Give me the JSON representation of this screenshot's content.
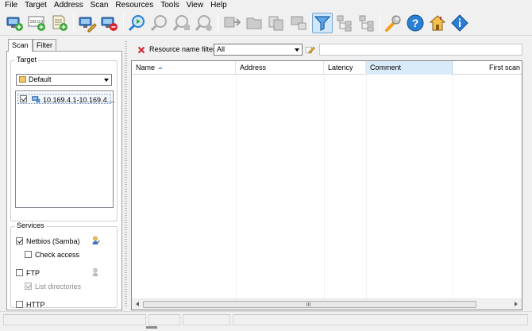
{
  "menu": [
    "File",
    "Target",
    "Address",
    "Scan",
    "Resources",
    "Tools",
    "View",
    "Help"
  ],
  "toolbar": {
    "icons": [
      "add-target-icon",
      "ip-address-icon",
      "add-list-icon",
      "edit-target-icon",
      "remove-target-icon",
      "scan-icon",
      "scan-disabled-icon",
      "scan-next-disabled-icon",
      "stop-scan-disabled-icon",
      "export-disabled-icon",
      "open-resource-disabled-icon",
      "copy-disabled-icon",
      "network-disabled-icon",
      "filter-icon",
      "tree-disabled-icon",
      "tree-expand-disabled-icon",
      "settings-wrench-icon",
      "help-icon",
      "home-icon",
      "about-icon"
    ],
    "ip_icon_text": "192.0.0"
  },
  "left": {
    "tabs": [
      "Scan",
      "Filter"
    ],
    "target_group_label": "Target",
    "target_select_value": "Default",
    "targets": [
      {
        "checked": true,
        "label": "10.169.4.1-10.169.4...."
      }
    ],
    "services_group_label": "Services",
    "services": [
      {
        "label": "Netbios (Samba)",
        "checked": true,
        "disabled": false
      },
      {
        "label": "Check access",
        "checked": false,
        "disabled": false
      },
      {
        "label": "FTP",
        "checked": false,
        "disabled": false
      },
      {
        "label": "List directories",
        "checked": true,
        "disabled": true
      },
      {
        "label": "HTTP",
        "checked": false,
        "disabled": false
      }
    ]
  },
  "right": {
    "filter_label": "Resource name filter",
    "filter_select_value": "All",
    "filter_text": "",
    "columns": [
      "Name",
      "Address",
      "Latency",
      "Comment",
      "First scan"
    ],
    "sorted_column": "Name",
    "selected_column": "Comment"
  },
  "colors": {
    "accent_blue": "#2a7fd4",
    "selection": "#d9ebf9",
    "remove_red": "#d9242b",
    "wrench_orange": "#f2a01a"
  }
}
